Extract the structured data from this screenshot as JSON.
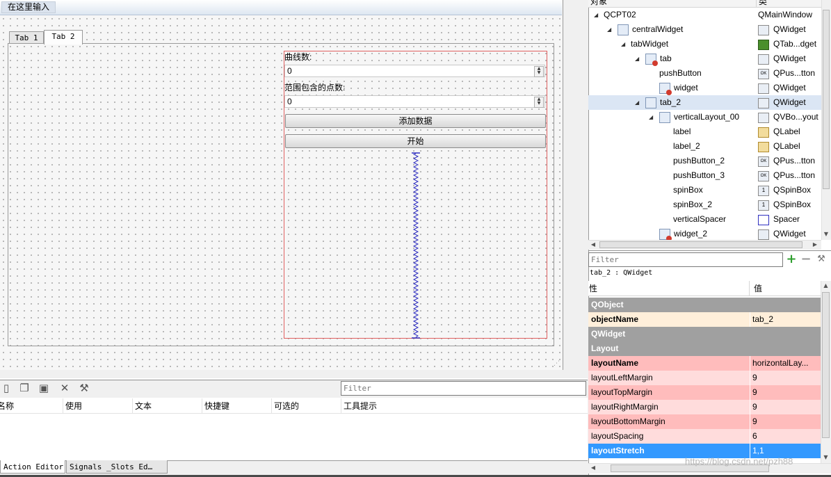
{
  "form": {
    "menu_placeholder": "在这里输入",
    "tabs": [
      "Tab 1",
      "Tab 2"
    ],
    "label_curves": "曲线数:",
    "spin_curves_value": "0",
    "label_points": "范围包含的点数:",
    "spin_points_value": "0",
    "button_add_data": "添加数据",
    "button_start": "开始"
  },
  "action_editor": {
    "filter_placeholder": "Filter",
    "columns": [
      "名称",
      "使用",
      "文本",
      "快捷键",
      "可选的",
      "工具提示"
    ],
    "bottom_tabs": [
      "Action Editor",
      "Signals _Slots Ed…"
    ]
  },
  "object_inspector": {
    "header": [
      "对象",
      "类"
    ],
    "rows": [
      {
        "name": "QCPT02",
        "class": "QMainWindow"
      },
      {
        "name": "centralWidget",
        "class": "QWidget"
      },
      {
        "name": "tabWidget",
        "class": "QTab...dget"
      },
      {
        "name": "tab",
        "class": "QWidget"
      },
      {
        "name": "pushButton",
        "class": "QPus...tton"
      },
      {
        "name": "widget",
        "class": "QWidget"
      },
      {
        "name": "tab_2",
        "class": "QWidget"
      },
      {
        "name": "verticalLayout_00",
        "class": "QVBo...yout"
      },
      {
        "name": "label",
        "class": "QLabel"
      },
      {
        "name": "label_2",
        "class": "QLabel"
      },
      {
        "name": "pushButton_2",
        "class": "QPus...tton"
      },
      {
        "name": "pushButton_3",
        "class": "QPus...tton"
      },
      {
        "name": "spinBox",
        "class": "QSpinBox"
      },
      {
        "name": "spinBox_2",
        "class": "QSpinBox"
      },
      {
        "name": "verticalSpacer",
        "class": "Spacer"
      },
      {
        "name": "widget_2",
        "class": "QWidget"
      }
    ]
  },
  "property_editor": {
    "filter_placeholder": "Filter",
    "object_label": "tab_2 : QWidget",
    "header": [
      "性",
      "值"
    ],
    "rows": [
      {
        "name": "QObject",
        "value": ""
      },
      {
        "name": "objectName",
        "value": "tab_2"
      },
      {
        "name": "QWidget",
        "value": ""
      },
      {
        "name": "Layout",
        "value": ""
      },
      {
        "name": "layoutName",
        "value": "horizontalLay..."
      },
      {
        "name": "layoutLeftMargin",
        "value": "9"
      },
      {
        "name": "layoutTopMargin",
        "value": "9"
      },
      {
        "name": "layoutRightMargin",
        "value": "9"
      },
      {
        "name": "layoutBottomMargin",
        "value": "9"
      },
      {
        "name": "layoutSpacing",
        "value": "6"
      },
      {
        "name": "layoutStretch",
        "value": "1,1"
      }
    ]
  },
  "watermark": "https://blog.csdn.net/pzh88",
  "colors": {
    "selection": "#3399ff",
    "layout_border": "#e06060",
    "spacer": "#3030c0",
    "section_row": "#a0a0a0"
  }
}
